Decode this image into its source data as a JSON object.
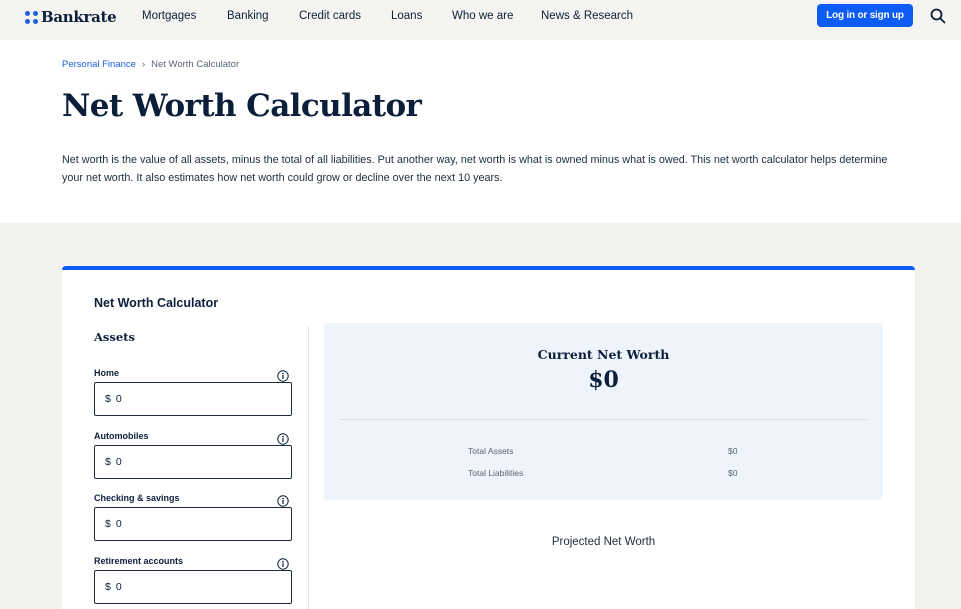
{
  "brand": {
    "name": "Bankrate",
    "accent": "#0d5cf5"
  },
  "nav": {
    "items": [
      {
        "label": "Mortgages"
      },
      {
        "label": "Banking"
      },
      {
        "label": "Credit cards"
      },
      {
        "label": "Loans"
      },
      {
        "label": "Who we are"
      },
      {
        "label": "News & Research"
      }
    ],
    "login_label": "Log in or sign up",
    "search_icon": "search-icon"
  },
  "breadcrumb": {
    "parent": "Personal Finance",
    "separator": "›",
    "current": "Net Worth Calculator"
  },
  "page": {
    "title": "Net Worth Calculator",
    "intro": "Net worth is the value of all assets, minus the total of all liabilities. Put another way, net worth is what is owned minus what is owed. This net worth calculator helps determine your net worth. It also estimates how net worth could grow or decline over the next 10 years."
  },
  "calculator": {
    "title": "Net Worth Calculator",
    "assets_heading": "Assets",
    "fields": [
      {
        "label": "Home",
        "currency": "$",
        "value": "0",
        "info_icon": "info-icon"
      },
      {
        "label": "Automobiles",
        "currency": "$",
        "value": "0",
        "info_icon": "info-icon"
      },
      {
        "label": "Checking & savings",
        "currency": "$",
        "value": "0",
        "info_icon": "info-icon"
      },
      {
        "label": "Retirement accounts",
        "currency": "$",
        "value": "0",
        "info_icon": "info-icon"
      }
    ],
    "summary": {
      "title": "Current Net Worth",
      "value": "$0",
      "rows": [
        {
          "label": "Total Assets",
          "value": "$0"
        },
        {
          "label": "Total Liabilities",
          "value": "$0"
        }
      ]
    },
    "projected_title": "Projected Net Worth"
  }
}
